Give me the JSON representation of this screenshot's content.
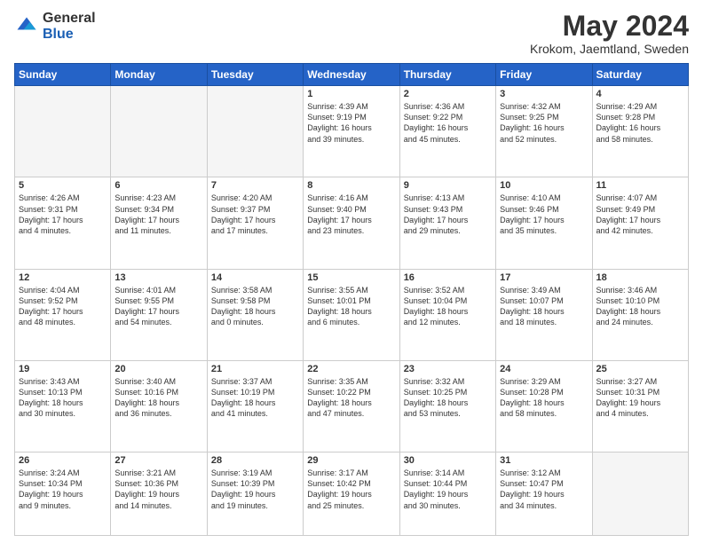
{
  "header": {
    "logo_general": "General",
    "logo_blue": "Blue",
    "month_year": "May 2024",
    "location": "Krokom, Jaemtland, Sweden"
  },
  "weekdays": [
    "Sunday",
    "Monday",
    "Tuesday",
    "Wednesday",
    "Thursday",
    "Friday",
    "Saturday"
  ],
  "weeks": [
    [
      {
        "day": "",
        "info": "",
        "empty": true
      },
      {
        "day": "",
        "info": "",
        "empty": true
      },
      {
        "day": "",
        "info": "",
        "empty": true
      },
      {
        "day": "1",
        "info": "Sunrise: 4:39 AM\nSunset: 9:19 PM\nDaylight: 16 hours\nand 39 minutes."
      },
      {
        "day": "2",
        "info": "Sunrise: 4:36 AM\nSunset: 9:22 PM\nDaylight: 16 hours\nand 45 minutes."
      },
      {
        "day": "3",
        "info": "Sunrise: 4:32 AM\nSunset: 9:25 PM\nDaylight: 16 hours\nand 52 minutes."
      },
      {
        "day": "4",
        "info": "Sunrise: 4:29 AM\nSunset: 9:28 PM\nDaylight: 16 hours\nand 58 minutes."
      }
    ],
    [
      {
        "day": "5",
        "info": "Sunrise: 4:26 AM\nSunset: 9:31 PM\nDaylight: 17 hours\nand 4 minutes."
      },
      {
        "day": "6",
        "info": "Sunrise: 4:23 AM\nSunset: 9:34 PM\nDaylight: 17 hours\nand 11 minutes."
      },
      {
        "day": "7",
        "info": "Sunrise: 4:20 AM\nSunset: 9:37 PM\nDaylight: 17 hours\nand 17 minutes."
      },
      {
        "day": "8",
        "info": "Sunrise: 4:16 AM\nSunset: 9:40 PM\nDaylight: 17 hours\nand 23 minutes."
      },
      {
        "day": "9",
        "info": "Sunrise: 4:13 AM\nSunset: 9:43 PM\nDaylight: 17 hours\nand 29 minutes."
      },
      {
        "day": "10",
        "info": "Sunrise: 4:10 AM\nSunset: 9:46 PM\nDaylight: 17 hours\nand 35 minutes."
      },
      {
        "day": "11",
        "info": "Sunrise: 4:07 AM\nSunset: 9:49 PM\nDaylight: 17 hours\nand 42 minutes."
      }
    ],
    [
      {
        "day": "12",
        "info": "Sunrise: 4:04 AM\nSunset: 9:52 PM\nDaylight: 17 hours\nand 48 minutes."
      },
      {
        "day": "13",
        "info": "Sunrise: 4:01 AM\nSunset: 9:55 PM\nDaylight: 17 hours\nand 54 minutes."
      },
      {
        "day": "14",
        "info": "Sunrise: 3:58 AM\nSunset: 9:58 PM\nDaylight: 18 hours\nand 0 minutes."
      },
      {
        "day": "15",
        "info": "Sunrise: 3:55 AM\nSunset: 10:01 PM\nDaylight: 18 hours\nand 6 minutes."
      },
      {
        "day": "16",
        "info": "Sunrise: 3:52 AM\nSunset: 10:04 PM\nDaylight: 18 hours\nand 12 minutes."
      },
      {
        "day": "17",
        "info": "Sunrise: 3:49 AM\nSunset: 10:07 PM\nDaylight: 18 hours\nand 18 minutes."
      },
      {
        "day": "18",
        "info": "Sunrise: 3:46 AM\nSunset: 10:10 PM\nDaylight: 18 hours\nand 24 minutes."
      }
    ],
    [
      {
        "day": "19",
        "info": "Sunrise: 3:43 AM\nSunset: 10:13 PM\nDaylight: 18 hours\nand 30 minutes."
      },
      {
        "day": "20",
        "info": "Sunrise: 3:40 AM\nSunset: 10:16 PM\nDaylight: 18 hours\nand 36 minutes."
      },
      {
        "day": "21",
        "info": "Sunrise: 3:37 AM\nSunset: 10:19 PM\nDaylight: 18 hours\nand 41 minutes."
      },
      {
        "day": "22",
        "info": "Sunrise: 3:35 AM\nSunset: 10:22 PM\nDaylight: 18 hours\nand 47 minutes."
      },
      {
        "day": "23",
        "info": "Sunrise: 3:32 AM\nSunset: 10:25 PM\nDaylight: 18 hours\nand 53 minutes."
      },
      {
        "day": "24",
        "info": "Sunrise: 3:29 AM\nSunset: 10:28 PM\nDaylight: 18 hours\nand 58 minutes."
      },
      {
        "day": "25",
        "info": "Sunrise: 3:27 AM\nSunset: 10:31 PM\nDaylight: 19 hours\nand 4 minutes."
      }
    ],
    [
      {
        "day": "26",
        "info": "Sunrise: 3:24 AM\nSunset: 10:34 PM\nDaylight: 19 hours\nand 9 minutes."
      },
      {
        "day": "27",
        "info": "Sunrise: 3:21 AM\nSunset: 10:36 PM\nDaylight: 19 hours\nand 14 minutes."
      },
      {
        "day": "28",
        "info": "Sunrise: 3:19 AM\nSunset: 10:39 PM\nDaylight: 19 hours\nand 19 minutes."
      },
      {
        "day": "29",
        "info": "Sunrise: 3:17 AM\nSunset: 10:42 PM\nDaylight: 19 hours\nand 25 minutes."
      },
      {
        "day": "30",
        "info": "Sunrise: 3:14 AM\nSunset: 10:44 PM\nDaylight: 19 hours\nand 30 minutes."
      },
      {
        "day": "31",
        "info": "Sunrise: 3:12 AM\nSunset: 10:47 PM\nDaylight: 19 hours\nand 34 minutes."
      },
      {
        "day": "",
        "info": "",
        "empty": true
      }
    ]
  ]
}
